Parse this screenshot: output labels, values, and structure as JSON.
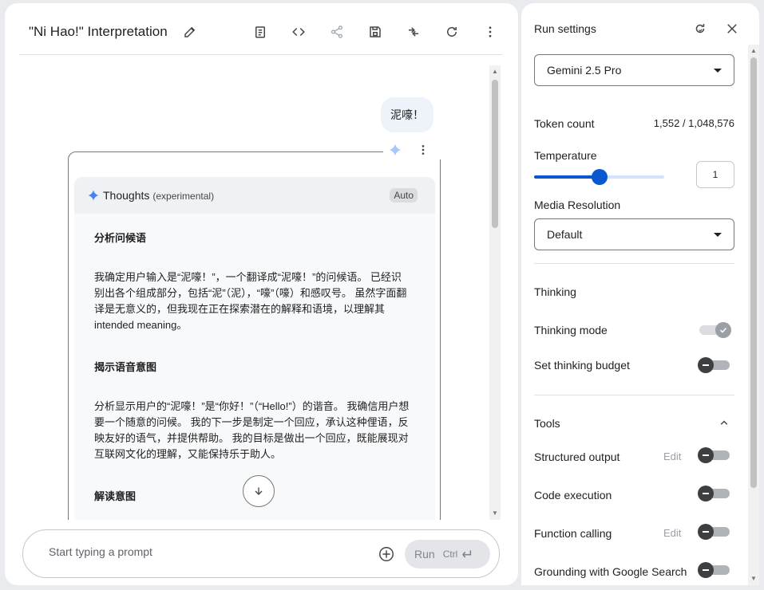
{
  "header": {
    "title": "\"Ni Hao!\" Interpretation"
  },
  "chat": {
    "user_message": "泥嚎！",
    "thoughts": {
      "title": "Thoughts",
      "subtitle": "(experimental)",
      "badge": "Auto",
      "sections": [
        {
          "heading": "分析问候语",
          "text": "我确定用户输入是“泥嚎！”，一个翻译成“泥嚎！”的问候语。 已经识别出各个组成部分，包括“泥”（泥），“嚎”（嚎）和感叹号。 虽然字面翻译是无意义的，但我现在正在探索潜在的解释和语境，以理解其 intended meaning。"
        },
        {
          "heading": "揭示语音意图",
          "text": "分析显示用户的“泥嚎！”是“你好！”（“Hello!”）的谐音。 我确信用户想要一个随意的问候。 我的下一步是制定一个回应，承认这种俚语，反映友好的语气，并提供帮助。 我的目标是做出一个回应，既能展现对互联网文化的理解，又能保持乐于助人。"
        },
        {
          "heading": "解读意图",
          "text": ""
        }
      ]
    }
  },
  "prompt": {
    "placeholder": "Start typing a prompt",
    "run_label": "Run",
    "run_shortcut": "Ctrl"
  },
  "run_settings": {
    "title": "Run settings",
    "model": "Gemini 2.5 Pro",
    "token_count_label": "Token count",
    "token_count_value": "1,552 / 1,048,576",
    "temperature_label": "Temperature",
    "temperature_value": "1",
    "temperature_fraction": 0.5,
    "media_resolution_label": "Media Resolution",
    "media_resolution_value": "Default",
    "thinking": {
      "section_title": "Thinking",
      "mode_label": "Thinking mode",
      "mode_on": true,
      "budget_label": "Set thinking budget",
      "budget_on": false
    },
    "tools": {
      "section_title": "Tools",
      "items": [
        {
          "label": "Structured output",
          "edit": "Edit",
          "on": false
        },
        {
          "label": "Code execution",
          "edit": "",
          "on": false
        },
        {
          "label": "Function calling",
          "edit": "Edit",
          "on": false
        },
        {
          "label": "Grounding with Google Search",
          "edit": "",
          "on": false
        }
      ]
    }
  },
  "colors": {
    "accent": "#0b57d0",
    "gemini_spark": "#4285f4"
  }
}
